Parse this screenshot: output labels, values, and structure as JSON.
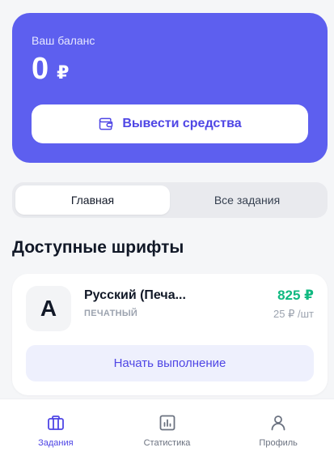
{
  "balance": {
    "label": "Ваш баланс",
    "value": "0",
    "currency": "₽",
    "withdraw_label": "Вывести средства"
  },
  "tabs": [
    {
      "label": "Главная",
      "active": true
    },
    {
      "label": "Все задания",
      "active": false
    }
  ],
  "section_title": "Доступные шрифты",
  "fonts": [
    {
      "letter": "A",
      "name": "Русский (Печа...",
      "type": "ПЕЧАТНЫЙ",
      "price": "825 ₽",
      "rate": "25 ₽ /шт",
      "action_label": "Начать выполнение"
    }
  ],
  "bottom_nav": [
    {
      "label": "Задания",
      "icon": "briefcase-icon",
      "active": true
    },
    {
      "label": "Статистика",
      "icon": "chart-icon",
      "active": false
    },
    {
      "label": "Профиль",
      "icon": "user-icon",
      "active": false
    }
  ],
  "colors": {
    "accent": "#5d5fef",
    "price": "#10b981",
    "background": "#f5f6f8"
  }
}
